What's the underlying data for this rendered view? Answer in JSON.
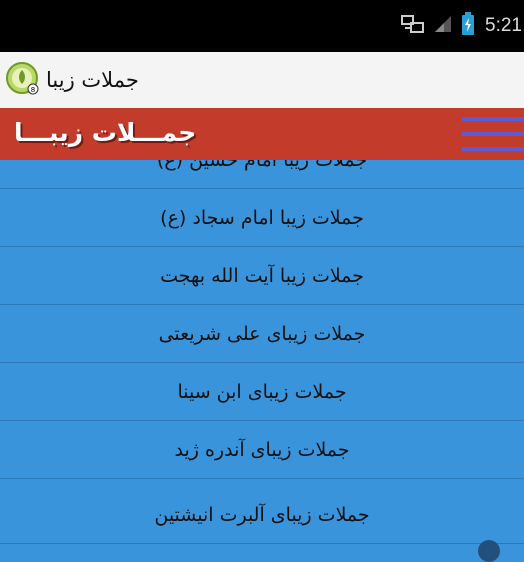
{
  "status_bar": {
    "time": "5:21",
    "icons": [
      "network-icon",
      "signal-icon",
      "battery-icon"
    ]
  },
  "action_bar": {
    "title": "جملات زیبا",
    "icon": "app-logo-icon"
  },
  "banner": {
    "title": "جمـــلات زیبـــا",
    "menu_icon": "hamburger-menu-icon"
  },
  "list": {
    "items": [
      {
        "label": "جملات زیبا امام حسین (ع)"
      },
      {
        "label": "جملات زیبا امام سجاد (ع)"
      },
      {
        "label": "جملات زیبا آیت الله بهجت"
      },
      {
        "label": "جملات  زیبای علی شریعتی"
      },
      {
        "label": "جملات زیبای ابن سینا"
      },
      {
        "label": "جملات  زیبای  آندره ژید"
      },
      {
        "label": "جملات  زیبای آلبرت انیشتین"
      }
    ]
  },
  "colors": {
    "status_bar": "#000000",
    "action_bar": "#f4f4f4",
    "banner": "#c23b2b",
    "list_background": "#3a94dc",
    "menu_lines": "#5b5bd6",
    "divider": "#2c78b6"
  }
}
